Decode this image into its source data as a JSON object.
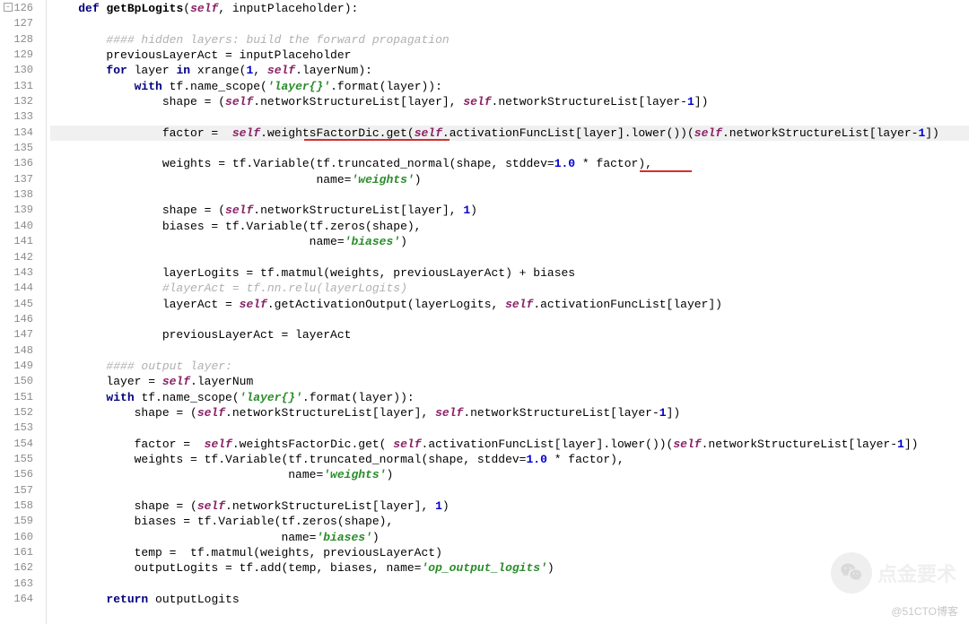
{
  "firstLine": 126,
  "lines": [
    {
      "n": 126,
      "t": "    <kw>def</kw> <fn>getBpLogits</fn>(<slf>self</slf>, inputPlaceholder):",
      "fold": true
    },
    {
      "n": 127,
      "t": ""
    },
    {
      "n": 128,
      "t": "        <cmt>#### hidden layers: build the forward propagation</cmt>"
    },
    {
      "n": 129,
      "t": "        previousLayerAct = inputPlaceholder"
    },
    {
      "n": 130,
      "t": "        <kw>for</kw> layer <kw>in</kw> xrange(<num>1</num>, <slf>self</slf>.layerNum):"
    },
    {
      "n": 131,
      "t": "            <kw>with</kw> tf.name_scope(<str>'layer{}'</str>.format(layer)):"
    },
    {
      "n": 132,
      "t": "                shape = (<slf>self</slf>.networkStructureList[layer], <slf>self</slf>.networkStructureList[layer-<num>1</num>])"
    },
    {
      "n": 133,
      "t": ""
    },
    {
      "n": 134,
      "t": "                factor =  <slf>self</slf>.weightsFactorDic.get(<slf>self</slf>.activationFuncList[layer].lower())(<slf>self</slf>.networkStructureList[layer-<num>1</num>])",
      "hl": true,
      "ul": [
        {
          "l": 283,
          "w": 162
        }
      ]
    },
    {
      "n": 135,
      "t": ""
    },
    {
      "n": 136,
      "t": "                weights = tf.Variable(tf.truncated_normal(shape, stddev=<num>1.0</num> * factor),",
      "ul": [
        {
          "l": 657,
          "w": 58
        }
      ]
    },
    {
      "n": 137,
      "t": "                                      name=<str>'weights'</str>)"
    },
    {
      "n": 138,
      "t": ""
    },
    {
      "n": 139,
      "t": "                shape = (<slf>self</slf>.networkStructureList[layer], <num>1</num>)"
    },
    {
      "n": 140,
      "t": "                biases = tf.Variable(tf.zeros(shape),"
    },
    {
      "n": 141,
      "t": "                                     name=<str>'biases'</str>)"
    },
    {
      "n": 142,
      "t": ""
    },
    {
      "n": 143,
      "t": "                layerLogits = tf.matmul(weights, previousLayerAct) + biases"
    },
    {
      "n": 144,
      "t": "                <cmt>#layerAct = tf.nn.relu(layerLogits)</cmt>"
    },
    {
      "n": 145,
      "t": "                layerAct = <slf>self</slf>.getActivationOutput(layerLogits, <slf>self</slf>.activationFuncList[layer])"
    },
    {
      "n": 146,
      "t": ""
    },
    {
      "n": 147,
      "t": "                previousLayerAct = layerAct"
    },
    {
      "n": 148,
      "t": ""
    },
    {
      "n": 149,
      "t": "        <cmt>#### output layer:</cmt>"
    },
    {
      "n": 150,
      "t": "        layer = <slf>self</slf>.layerNum"
    },
    {
      "n": 151,
      "t": "        <kw>with</kw> tf.name_scope(<str>'layer{}'</str>.format(layer)):"
    },
    {
      "n": 152,
      "t": "            shape = (<slf>self</slf>.networkStructureList[layer], <slf>self</slf>.networkStructureList[layer-<num>1</num>])"
    },
    {
      "n": 153,
      "t": ""
    },
    {
      "n": 154,
      "t": "            factor =  <slf>self</slf>.weightsFactorDic.get( <slf>self</slf>.activationFuncList[layer].lower())(<slf>self</slf>.networkStructureList[layer-<num>1</num>])"
    },
    {
      "n": 155,
      "t": "            weights = tf.Variable(tf.truncated_normal(shape, stddev=<num>1.0</num> * factor),"
    },
    {
      "n": 156,
      "t": "                                  name=<str>'weights'</str>)"
    },
    {
      "n": 157,
      "t": ""
    },
    {
      "n": 158,
      "t": "            shape = (<slf>self</slf>.networkStructureList[layer], <num>1</num>)"
    },
    {
      "n": 159,
      "t": "            biases = tf.Variable(tf.zeros(shape),"
    },
    {
      "n": 160,
      "t": "                                 name=<str>'biases'</str>)"
    },
    {
      "n": 161,
      "t": "            temp =  tf.matmul(weights, previousLayerAct)"
    },
    {
      "n": 162,
      "t": "            outputLogits = tf.add(temp, biases, name=<str>'op_output_logits'</str>)"
    },
    {
      "n": 163,
      "t": ""
    },
    {
      "n": 164,
      "t": "        <kw>return</kw> outputLogits"
    }
  ],
  "watermark_text": "点金要术",
  "footer_text": "@51CTO博客"
}
